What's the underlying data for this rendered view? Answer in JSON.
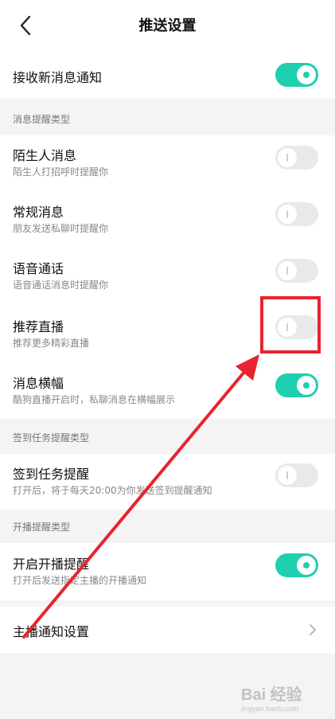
{
  "header": {
    "title": "推送设置",
    "back_icon": "chevron-left-icon"
  },
  "rows": {
    "receive_notify": {
      "title": "接收新消息通知",
      "toggle_on": true
    },
    "stranger": {
      "title": "陌生人消息",
      "subtitle": "陌生人打招呼时提醒你",
      "toggle_on": false
    },
    "regular": {
      "title": "常规消息",
      "subtitle": "朋友发送私聊时提醒你",
      "toggle_on": false
    },
    "voice": {
      "title": "语音通话",
      "subtitle": "语音通话消息时提醒你",
      "toggle_on": false
    },
    "live": {
      "title": "推荐直播",
      "subtitle": "推荐更多精彩直播",
      "toggle_on": false
    },
    "banner": {
      "title": "消息横幅",
      "subtitle": "酷狗直播开启时，私聊消息在横幅展示",
      "toggle_on": true
    },
    "checkin": {
      "title": "签到任务提醒",
      "subtitle": "打开后，将于每天20:00为你发送签到提醒通知",
      "toggle_on": false
    },
    "broadcast": {
      "title": "开启开播提醒",
      "subtitle": "打开后发送指定主播的开播通知",
      "toggle_on": true
    },
    "host_settings": {
      "title": "主播通知设置"
    }
  },
  "sections": {
    "message_types": "消息提醒类型",
    "checkin_types": "签到任务提醒类型",
    "broadcast_types": "开播提醒类型"
  },
  "colors": {
    "accent": "#1ecfb0",
    "toggle_off": "#e9e9e9",
    "annotation": "#e8242f",
    "background": "#f4f4f4"
  },
  "watermark": {
    "text": "Bai 经验",
    "sub": "jingyan.baidu.com"
  }
}
